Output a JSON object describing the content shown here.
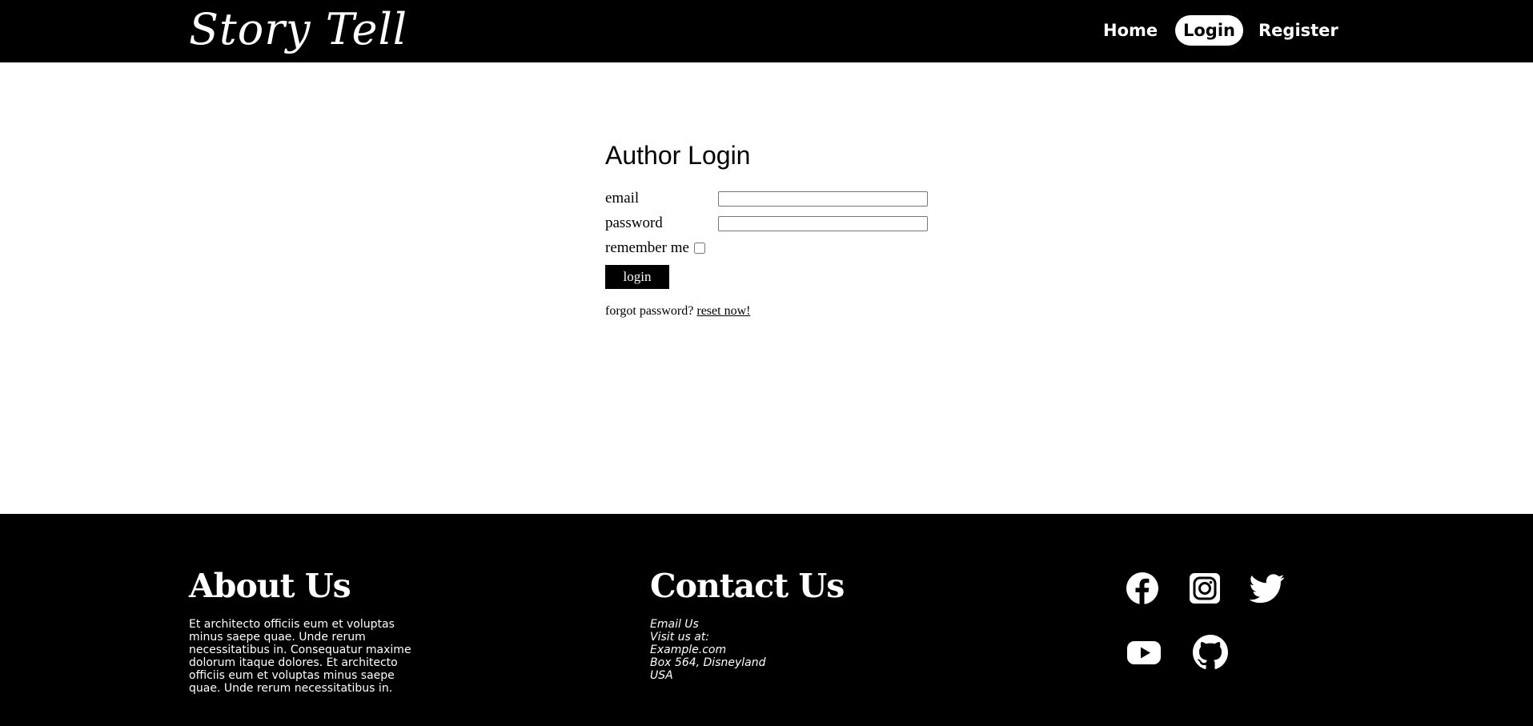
{
  "header": {
    "logo_text": "Story Tell",
    "nav": [
      {
        "label": "Home"
      },
      {
        "label": "Login",
        "active": true
      },
      {
        "label": "Register"
      }
    ]
  },
  "login": {
    "title": "Author Login",
    "email_label": "email",
    "email_value": "",
    "password_label": "password",
    "password_value": "",
    "remember_label": "remember me",
    "remember_checked": false,
    "submit_label": "login",
    "forgot_text": "forgot password?",
    "reset_link": "reset now!"
  },
  "footer": {
    "about_title": "About Us",
    "about_text": "Et architecto officiis eum et voluptas minus saepe quae. Unde rerum necessitatibus in. Consequatur maxime dolorum itaque dolores. Et architecto officiis eum et voluptas minus saepe quae. Unde rerum necessitatibus in.",
    "contact_title": "Contact Us",
    "contact_lines": [
      "Email Us",
      "Visit us at:",
      "Example.com",
      "Box 564, Disneyland",
      "USA"
    ],
    "social_icons": [
      "facebook-icon",
      "instagram-icon",
      "twitter-icon",
      "youtube-icon",
      "github-icon"
    ]
  },
  "colors": {
    "header_bg": "#000000",
    "footer_bg": "#000000",
    "accent": "#ffffff",
    "button_bg": "#000000"
  }
}
